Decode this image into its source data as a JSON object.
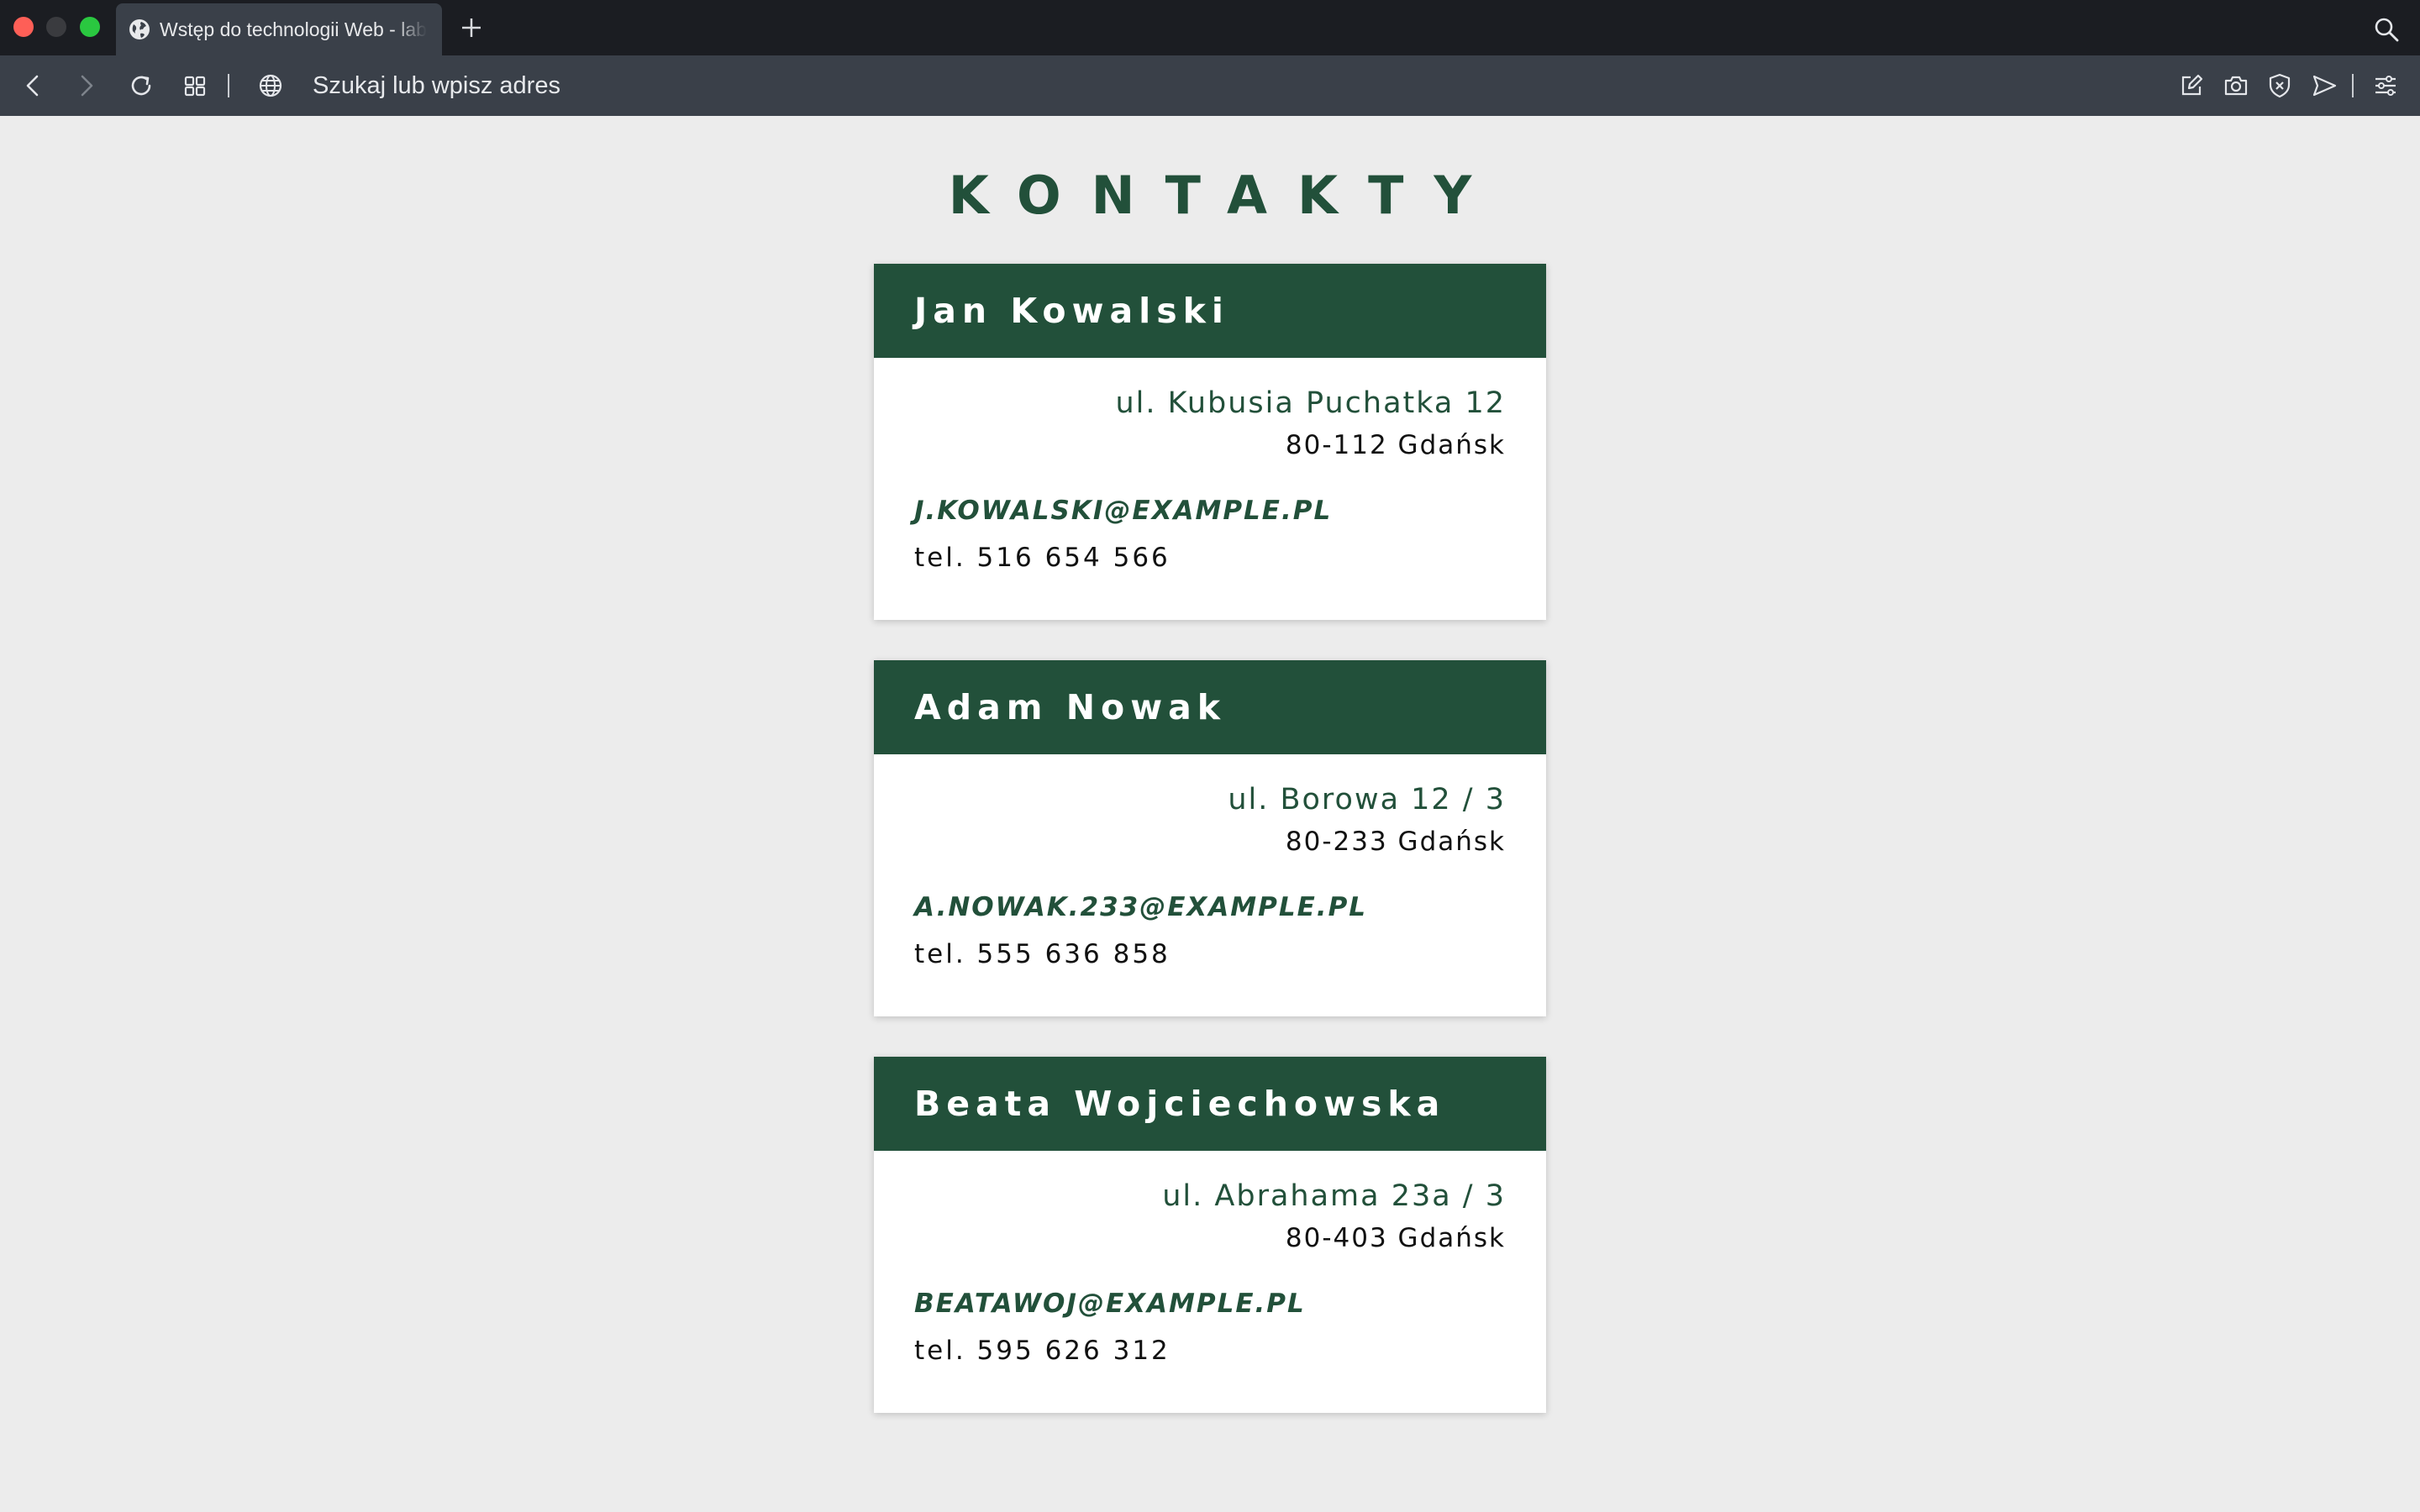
{
  "browser": {
    "tab_title": "Wstęp do technologii Web - lab",
    "address_placeholder": "Szukaj lub wpisz adres"
  },
  "page": {
    "heading": "KONTAKTY",
    "accent_color": "#22503a",
    "contacts": [
      {
        "name": "Jan Kowalski",
        "street": "ul. Kubusia Puchatka 12",
        "city": "80-112 Gdańsk",
        "email": "j.kowalski@example.pl",
        "phone": "tel. 516 654 566"
      },
      {
        "name": "Adam Nowak",
        "street": "ul. Borowa 12 / 3",
        "city": "80-233 Gdańsk",
        "email": "a.nowak.233@example.pl",
        "phone": "tel. 555 636 858"
      },
      {
        "name": "Beata Wojciechowska",
        "street": "ul. Abrahama 23a / 3",
        "city": "80-403 Gdańsk",
        "email": "beatawoj@example.pl",
        "phone": "tel. 595 626 312"
      }
    ]
  }
}
